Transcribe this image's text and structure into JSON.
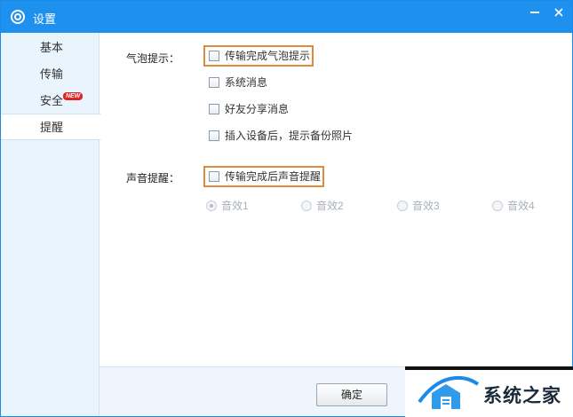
{
  "window": {
    "title": "设置"
  },
  "sidebar": {
    "items": [
      {
        "label": "基本",
        "active": false
      },
      {
        "label": "传输",
        "active": false
      },
      {
        "label": "安全",
        "active": false,
        "badge": "NEW"
      },
      {
        "label": "提醒",
        "active": true
      }
    ]
  },
  "bubble": {
    "label": "气泡提示：",
    "options": [
      {
        "label": "传输完成气泡提示",
        "checked": false
      },
      {
        "label": "系统消息",
        "checked": false
      },
      {
        "label": "好友分享消息",
        "checked": false
      },
      {
        "label": "插入设备后，提示备份照片",
        "checked": false
      }
    ]
  },
  "sound": {
    "label": "声音提醒：",
    "option": {
      "label": "传输完成后声音提醒",
      "checked": false
    },
    "effects": [
      {
        "label": "音效1",
        "selected": true
      },
      {
        "label": "音效2",
        "selected": false
      },
      {
        "label": "音效3",
        "selected": false
      },
      {
        "label": "音效4",
        "selected": false
      }
    ]
  },
  "footer": {
    "ok_label": "确定"
  },
  "watermark": {
    "text": "系统之家"
  },
  "colors": {
    "titlebar": "#1e90ee",
    "highlight": "#e08a3c",
    "badge": "#e02424"
  }
}
